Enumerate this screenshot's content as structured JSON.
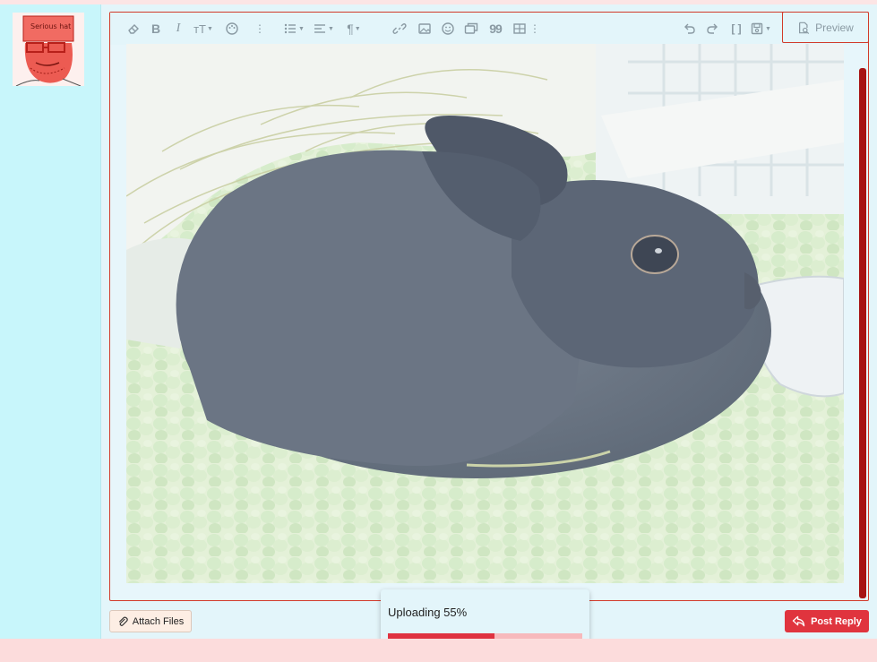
{
  "avatar": {
    "caption": "Serious hat"
  },
  "toolbar": {
    "buttons": [
      {
        "name": "eraser-icon"
      },
      {
        "name": "bold-icon",
        "glyph": "B"
      },
      {
        "name": "italic-icon",
        "glyph": "I"
      },
      {
        "name": "text-size-icon",
        "glyph": "тТ"
      },
      {
        "name": "palette-icon"
      },
      {
        "name": "more-vertical-icon"
      },
      {
        "name": "list-icon"
      },
      {
        "name": "align-icon"
      },
      {
        "name": "paragraph-icon",
        "glyph": "¶"
      },
      {
        "name": "link-icon"
      },
      {
        "name": "image-icon"
      },
      {
        "name": "emoji-icon"
      },
      {
        "name": "media-icon"
      },
      {
        "name": "quote-icon",
        "glyph": "99"
      },
      {
        "name": "table-icon"
      },
      {
        "name": "more-vertical-icon"
      },
      {
        "name": "undo-icon"
      },
      {
        "name": "redo-icon"
      },
      {
        "name": "bbcode-brackets-icon",
        "glyph": "[ ]"
      },
      {
        "name": "drafts-icon"
      }
    ],
    "preview_label": "Preview"
  },
  "actions": {
    "attach_label": "Attach Files",
    "post_label": "Post Reply"
  },
  "upload": {
    "label": "Uploading 55%",
    "progress": 0.55
  },
  "colors": {
    "accent": "#e0343e",
    "border": "#d23a2a",
    "panel": "#e3f5fa",
    "sidebar": "#c8f6fb"
  }
}
